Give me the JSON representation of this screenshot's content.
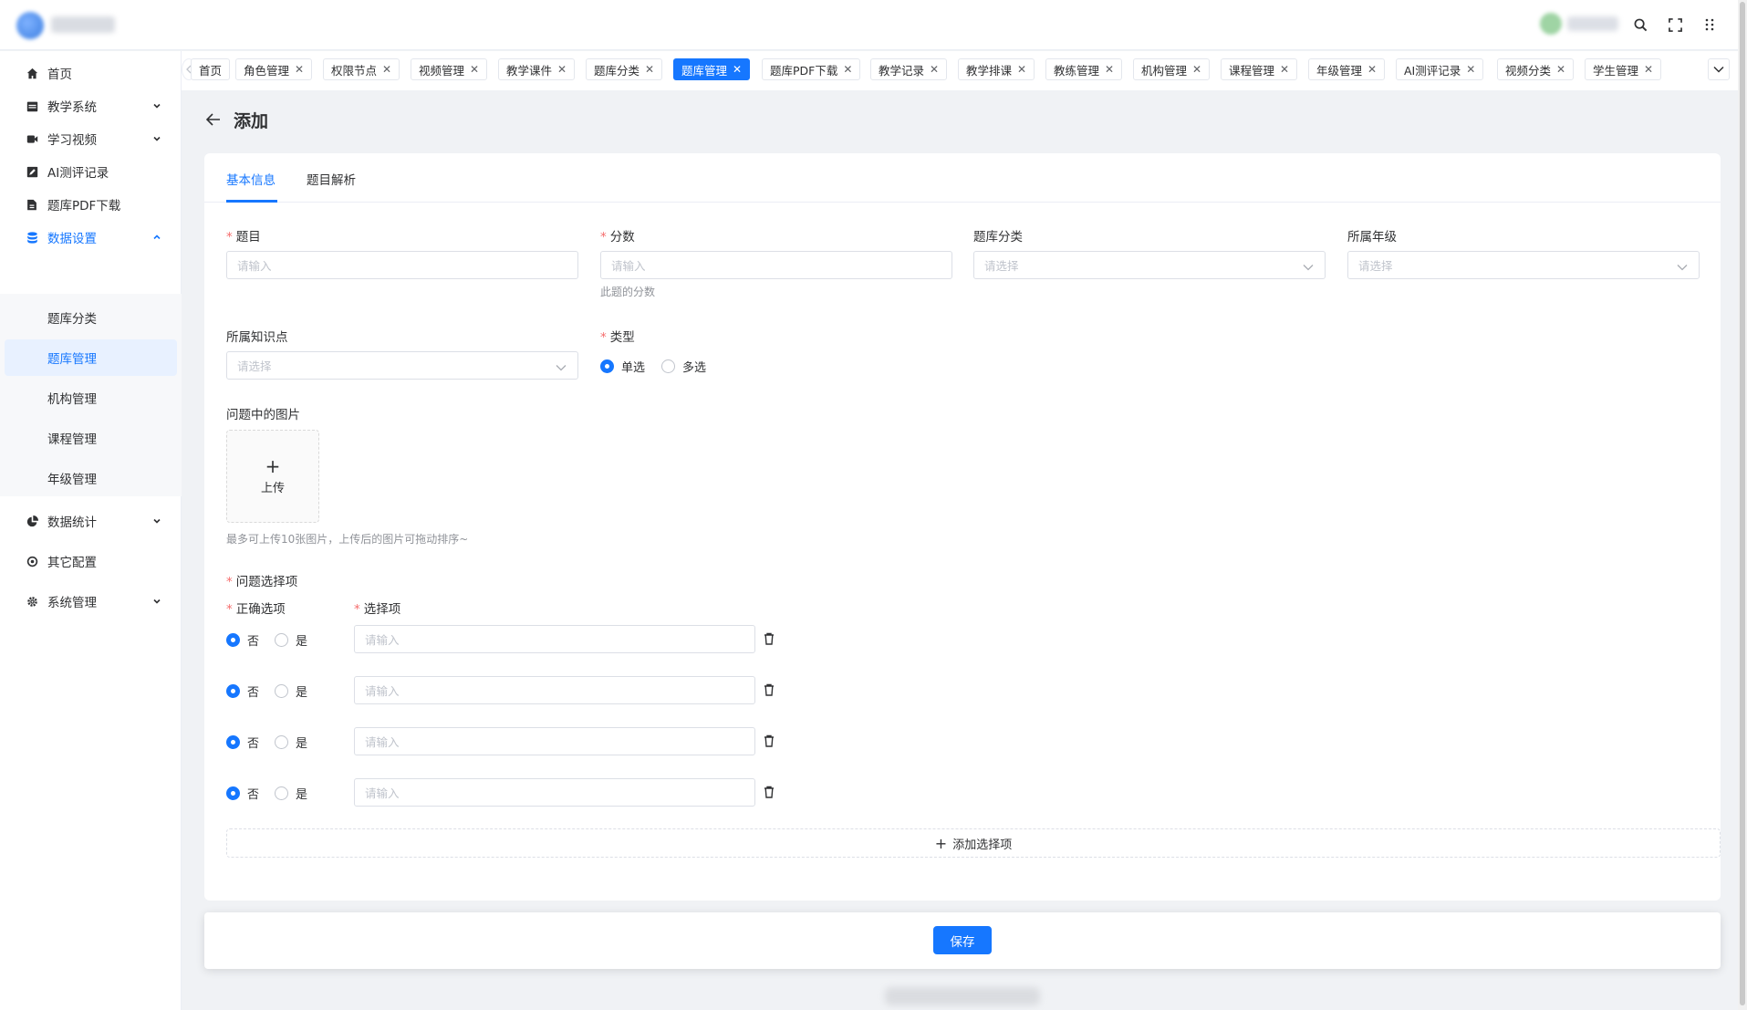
{
  "header": {
    "icons": [
      "search-icon",
      "fullscreen-icon",
      "more-grid-icon"
    ]
  },
  "sidebar": {
    "items": [
      {
        "label": "首页",
        "icon": "home-icon"
      },
      {
        "label": "教学系统",
        "icon": "calendar-icon"
      },
      {
        "label": "学习视频",
        "icon": "video-icon"
      },
      {
        "label": "AI测评记录",
        "icon": "edit-icon"
      },
      {
        "label": "题库PDF下载",
        "icon": "file-icon"
      },
      {
        "label": "数据设置",
        "icon": "database-icon"
      },
      {
        "label": "数据统计",
        "icon": "pie-chart-icon"
      },
      {
        "label": "其它配置",
        "icon": "settings-circle-icon"
      },
      {
        "label": "系统管理",
        "icon": "gear-icon"
      }
    ],
    "sub_items": [
      "题库分类",
      "题库管理",
      "机构管理",
      "课程管理",
      "年级管理"
    ]
  },
  "tabs": [
    "首页",
    "角色管理",
    "权限节点",
    "视频管理",
    "教学课件",
    "题库分类",
    "题库管理",
    "题库PDF下载",
    "教学记录",
    "教学排课",
    "教练管理",
    "机构管理",
    "课程管理",
    "年级管理",
    "AI测评记录",
    "视频分类",
    "学生管理"
  ],
  "page": {
    "title": "添加",
    "card_tabs": [
      "基本信息",
      "题目解析"
    ]
  },
  "form": {
    "question_label": "题目",
    "question_placeholder": "请输入",
    "score_label": "分数",
    "score_placeholder": "请输入",
    "score_hint": "此题的分数",
    "category_label": "题库分类",
    "category_placeholder": "请选择",
    "grade_label": "所属年级",
    "grade_placeholder": "请选择",
    "knowledge_label": "所属知识点",
    "knowledge_placeholder": "请选择",
    "type_label": "类型",
    "type_single": "单选",
    "type_multi": "多选",
    "images_label": "问题中的图片",
    "upload_label": "上传",
    "upload_hint": "最多可上传10张图片，上传后的图片可拖动排序~",
    "options_label": "问题选择项",
    "correct_label": "正确选项",
    "option_label": "选择项",
    "no_label": "否",
    "yes_label": "是",
    "option_placeholder": "请输入",
    "add_option_label": "添加选择项"
  },
  "footer": {
    "save_label": "保存"
  },
  "colors": {
    "accent": "#1677ff",
    "required": "#f56c6c"
  }
}
